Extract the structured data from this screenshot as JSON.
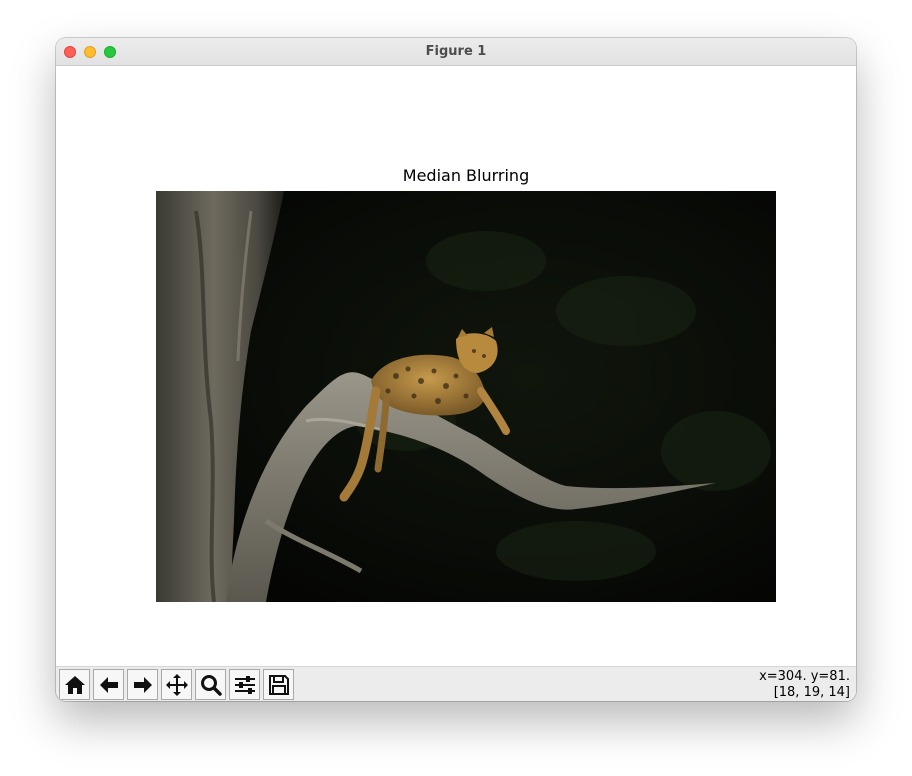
{
  "window": {
    "title": "Figure 1"
  },
  "figure": {
    "axes_title": "Median Blurring"
  },
  "toolbar": {
    "buttons": [
      {
        "name": "home",
        "icon": "home-icon"
      },
      {
        "name": "back",
        "icon": "arrow-left-icon"
      },
      {
        "name": "forward",
        "icon": "arrow-right-icon"
      },
      {
        "name": "pan",
        "icon": "move-icon"
      },
      {
        "name": "zoom",
        "icon": "magnifier-icon"
      },
      {
        "name": "configure-subplots",
        "icon": "sliders-icon"
      },
      {
        "name": "save",
        "icon": "floppy-disk-icon"
      }
    ]
  },
  "status": {
    "coords": "x=304. y=81.",
    "pixel_value": "[18, 19, 14]"
  },
  "colors": {
    "close": "#fe5f57",
    "minimize": "#febc2e",
    "maximize": "#28c840",
    "toolbar_bg": "#ececec"
  }
}
